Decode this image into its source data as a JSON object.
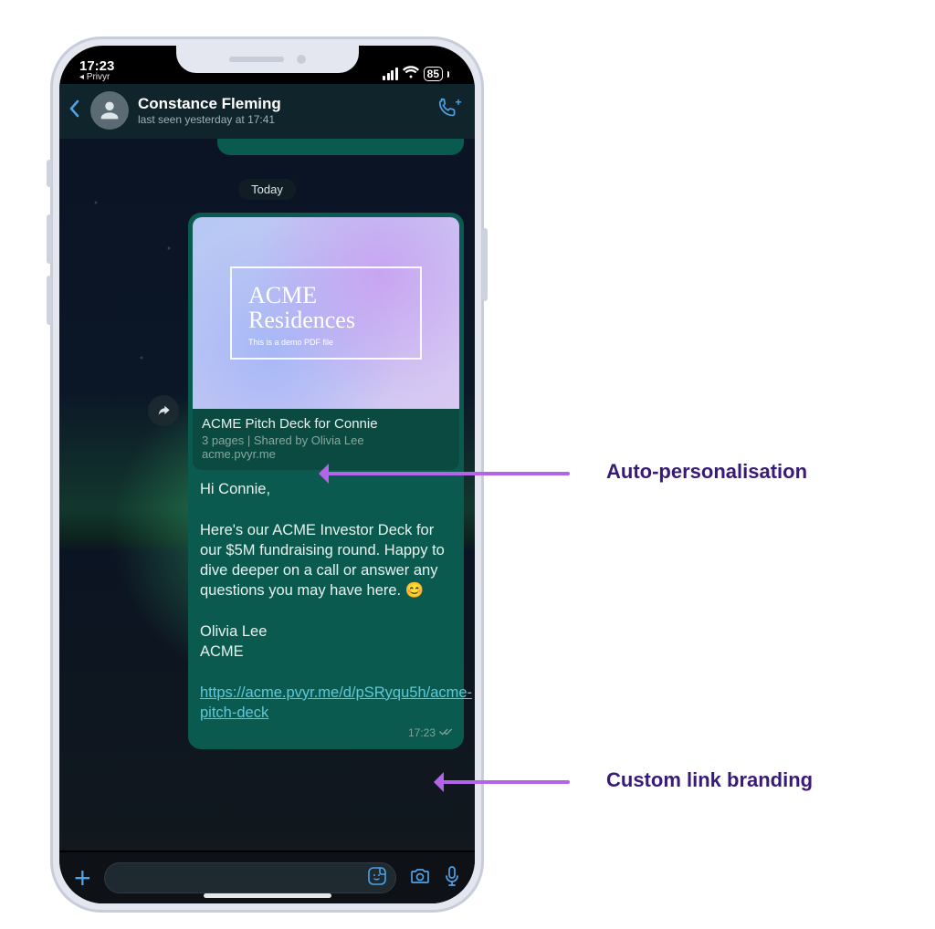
{
  "status": {
    "time": "17:23",
    "back_app": "◂ Privyr",
    "battery": "85"
  },
  "header": {
    "name": "Constance Fleming",
    "last_seen": "last seen yesterday at 17:41"
  },
  "chat": {
    "date_label": "Today",
    "preview": {
      "brand_line1": "ACME",
      "brand_line2": "Residences",
      "subtext": "This is a demo PDF file",
      "title": "ACME Pitch Deck for Connie",
      "meta": "3 pages | Shared by Olivia Lee",
      "domain": "acme.pvyr.me"
    },
    "message": {
      "greeting": "Hi Connie,",
      "body": "Here's our ACME Investor Deck for our $5M fundraising round. Happy to dive deeper on a call or answer any questions you may have here. 😊",
      "signoff1": "Olivia Lee",
      "signoff2": "ACME",
      "link": "https://acme.pvyr.me/d/pSRyqu5h/acme-pitch-deck",
      "time": "17:23"
    }
  },
  "callouts": {
    "auto": "Auto-personalisation",
    "link": "Custom link branding"
  }
}
